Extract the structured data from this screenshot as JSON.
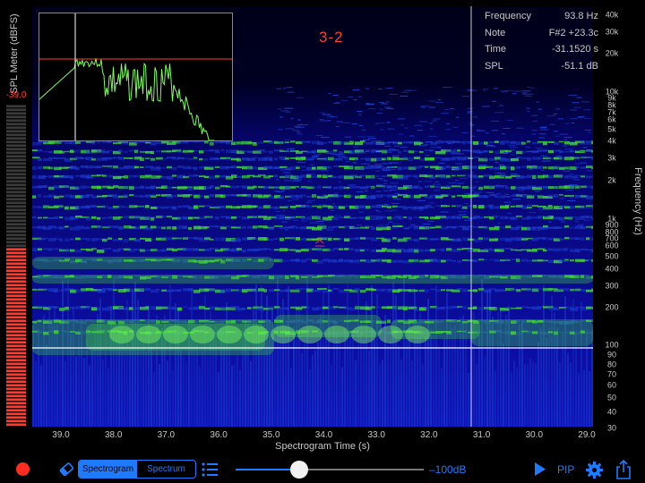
{
  "spl_meter": {
    "label": "SPL Meter (dBFS)",
    "value": "-39.0",
    "level_fraction": 0.55,
    "active_color": "#ff3b30",
    "inactive_color": "#3a3a3a"
  },
  "spectrogram": {
    "segment_label": "3-2",
    "note_marker": "스",
    "axis_title": "Spectrogram Time (s)",
    "time_ticks": [
      "39.0",
      "38.0",
      "37.0",
      "36.0",
      "35.0",
      "34.0",
      "33.0",
      "32.0",
      "31.0",
      "30.0",
      "29.0"
    ],
    "freq_title": "Frequency (Hz)",
    "freq_ticks": [
      "40k",
      "30k",
      "20k",
      "10k",
      "9k",
      "8k",
      "7k",
      "6k",
      "5k",
      "4k",
      "3k",
      "2k",
      "1k",
      "900",
      "800",
      "700",
      "600",
      "500",
      "400",
      "300",
      "200",
      "100",
      "90",
      "80",
      "70",
      "60",
      "50",
      "40",
      "30"
    ],
    "colors": {
      "low": "#0a0a8c",
      "mid": "#1f3fd0",
      "high": "#3dd13a",
      "peak": "#7dff5a"
    }
  },
  "readout": {
    "rows": [
      {
        "label": "Frequency",
        "value": "93.8 Hz"
      },
      {
        "label": "Note",
        "value": "F#2 +23.3c"
      },
      {
        "label": "Time",
        "value": "-31.1520 s"
      },
      {
        "label": "SPL",
        "value": "-51.1 dB"
      }
    ]
  },
  "toolbar": {
    "record_icon": "record-icon",
    "eraser_icon": "eraser-icon",
    "tabs": [
      {
        "label": "Spectrogram",
        "active": true
      },
      {
        "label": "Spectrum",
        "active": false
      }
    ],
    "list_icon": "list-icon",
    "gain_slider_fraction": 0.34,
    "gain_label": "–100dB",
    "play_icon": "play-icon",
    "pip_label": "PIP",
    "gear_icon": "gear-icon",
    "share_icon": "share-icon",
    "accent_color": "#1e7bff"
  }
}
